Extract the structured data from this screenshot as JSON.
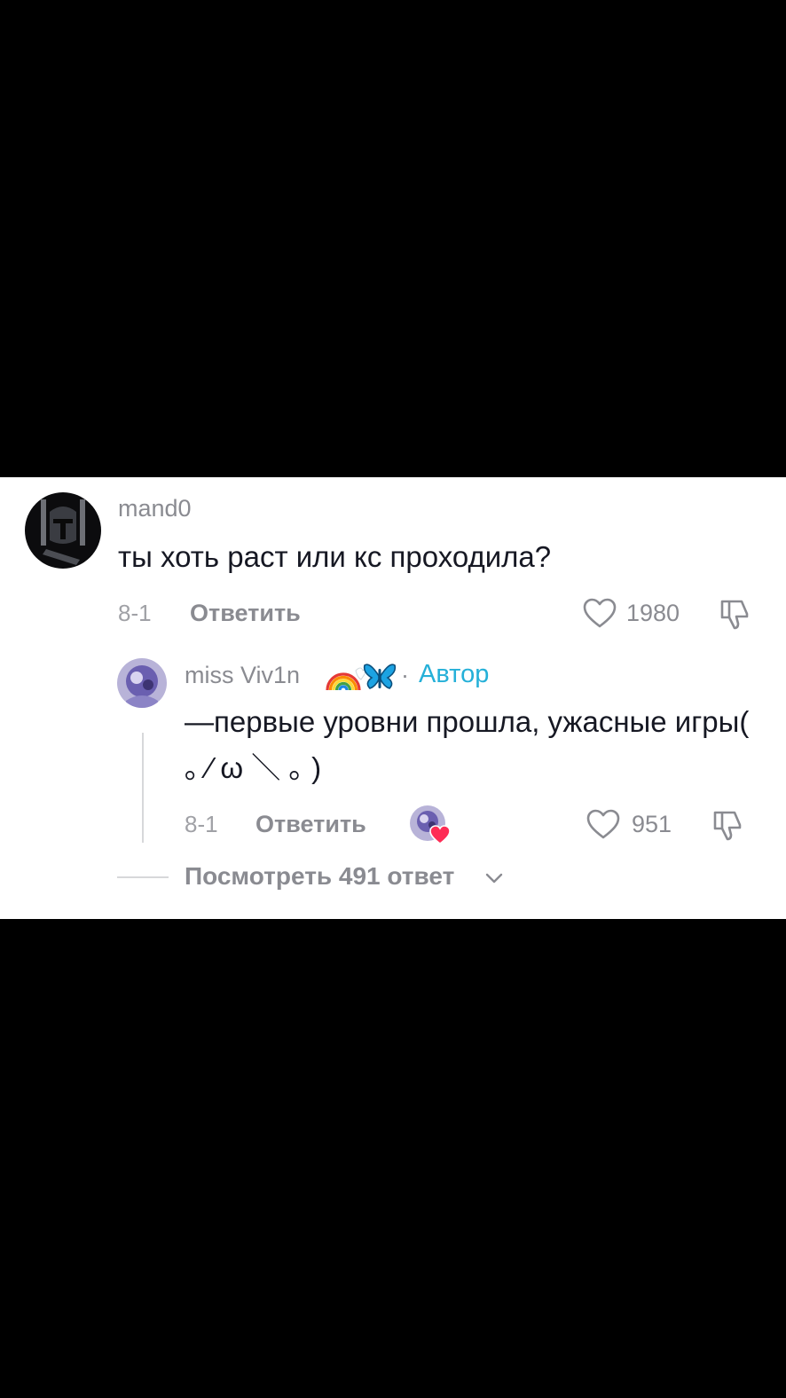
{
  "comment": {
    "username": "mand0",
    "text": "ты хоть раст или кс проходила?",
    "date": "8-1",
    "reply_label": "Ответить",
    "likes": "1980"
  },
  "reply": {
    "username": "miss Viv1n",
    "emoji": "rainbow-emoji butterfly-emoji",
    "separator": "·",
    "author_badge": "Автор",
    "text": "—первые уровни прошла, ужасные игры( ｡ ⁄ ω ＼ ｡ )",
    "date": "8-1",
    "reply_label": "Ответить",
    "likes": "951"
  },
  "view_more": {
    "label": "Посмотреть 491 ответ"
  },
  "colors": {
    "background": "#000000",
    "panel": "#ffffff",
    "text_primary": "#161823",
    "text_secondary": "#8a8b91",
    "author_badge": "#25b0d8",
    "heart_badge": "#fe2c55"
  }
}
